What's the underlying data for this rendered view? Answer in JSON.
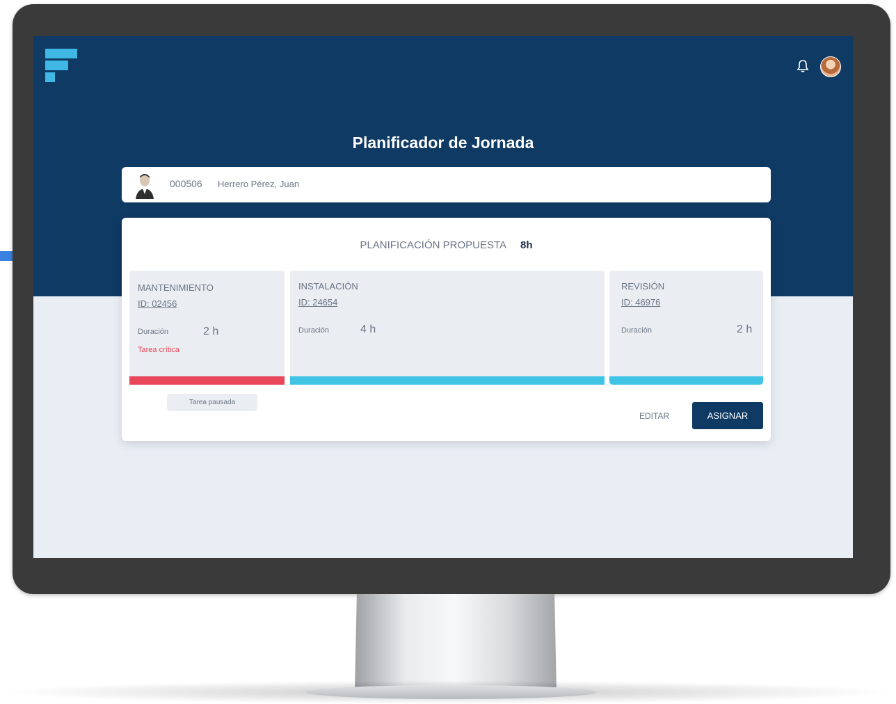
{
  "app": {
    "title": "Planificador de Jornada"
  },
  "header": {
    "icons": [
      "logo-icon",
      "bell-icon",
      "user-avatar"
    ]
  },
  "worker": {
    "id": "000506",
    "name": "Herrero Pérez, Juan"
  },
  "plan": {
    "label": "PLANIFICACIÓN PROPUESTA",
    "total_hours": "8h",
    "tasks": [
      {
        "category": "MANTENIMIENTO",
        "id_text": "ID: 02456",
        "duration_label": "Duración",
        "duration_value": "2 h",
        "note": "Tarea crítica",
        "status_color": "#e8465a"
      },
      {
        "category": "INSTALACIÓN",
        "id_text": "ID: 24654",
        "duration_label": "Duración",
        "duration_value": "4 h",
        "note": "",
        "status_color": "#3fc4e6"
      },
      {
        "category": "REVISIÓN",
        "id_text": "ID: 46976",
        "duration_label": "Duración",
        "duration_value": "2 h",
        "note": "",
        "status_color": "#3fc4e6"
      }
    ],
    "paused_button": "Tarea pausada",
    "edit_button": "EDITAR",
    "assign_button": "ASIGNAR"
  },
  "colors": {
    "primary": "#0f3a64",
    "accent": "#3fb8e6",
    "critical": "#e8465a"
  }
}
